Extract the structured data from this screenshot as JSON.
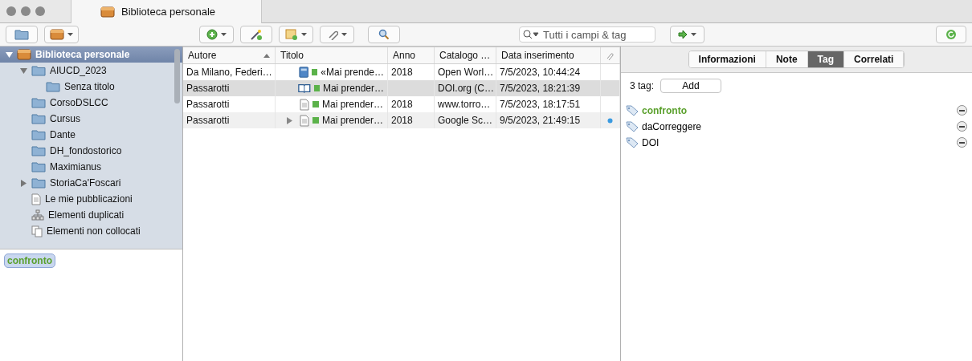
{
  "window": {
    "tab_title": "Biblioteca personale"
  },
  "search": {
    "placeholder": "Tutti i campi & tag"
  },
  "sidebar": {
    "items": [
      {
        "label": "Biblioteca personale",
        "kind": "library",
        "selected": true,
        "expanded": true,
        "children": [
          {
            "label": "AIUCD_2023",
            "kind": "folder",
            "selected": false,
            "expanded": true,
            "children": [
              {
                "label": "Senza titolo",
                "kind": "folder",
                "selected": false
              }
            ]
          },
          {
            "label": "CorsoDSLCC",
            "kind": "folder",
            "selected": false
          },
          {
            "label": "Cursus",
            "kind": "folder",
            "selected": false
          },
          {
            "label": "Dante",
            "kind": "folder",
            "selected": false
          },
          {
            "label": "DH_fondostorico",
            "kind": "folder",
            "selected": false
          },
          {
            "label": "Maximianus",
            "kind": "folder",
            "selected": false
          },
          {
            "label": "StoriaCa'Foscari",
            "kind": "folder",
            "selected": false,
            "expanded": false
          },
          {
            "label": "Le mie pubblicazioni",
            "kind": "document",
            "selected": false
          },
          {
            "label": "Elementi duplicati",
            "kind": "duplicates",
            "selected": false
          },
          {
            "label": "Elementi non collocati",
            "kind": "unfiled",
            "selected": false
          }
        ]
      }
    ]
  },
  "tag_selector": {
    "tags": [
      {
        "label": "confronto",
        "color": "#5aa02c"
      }
    ]
  },
  "table": {
    "columns": [
      "Autore",
      "Titolo",
      "Anno",
      "Catalogo …",
      "Data inserimento"
    ],
    "rows": [
      {
        "author": "Da Milano, Federi…",
        "kind": "book",
        "title": "«Mai prende…",
        "year": "2018",
        "catalog": "Open Worl…",
        "date": "7/5/2023, 10:44:24",
        "selected": false,
        "expandable": false,
        "attachment": false
      },
      {
        "author": "Passarotti",
        "kind": "book-section",
        "title": "Mai prender…",
        "catalog": "DOI.org (C…",
        "date": "7/5/2023, 18:21:39",
        "selected": true,
        "expandable": false,
        "attachment": false
      },
      {
        "author": "Passarotti",
        "kind": "document",
        "title": "Mai prender…",
        "year": "2018",
        "catalog": "www.torro…",
        "date": "7/5/2023, 18:17:51",
        "selected": false,
        "expandable": false,
        "attachment": false
      },
      {
        "author": "Passarotti",
        "kind": "document",
        "title": "Mai prender…",
        "year": "2018",
        "catalog": "Google Sc…",
        "date": "9/5/2023, 21:49:15",
        "selected": false,
        "expandable": true,
        "attachment": true
      }
    ]
  },
  "item_pane": {
    "tabs": [
      {
        "label": "Informazioni",
        "selected": false
      },
      {
        "label": "Note",
        "selected": false
      },
      {
        "label": "Tag",
        "selected": true
      },
      {
        "label": "Correlati",
        "selected": false
      }
    ],
    "count": "3 tag:",
    "add_button": "Add",
    "tags": [
      {
        "label": "confronto",
        "color": "#5aa02c"
      },
      {
        "label": "daCorreggere",
        "color": "#000000"
      },
      {
        "label": "DOI",
        "color": "#000000"
      }
    ]
  }
}
